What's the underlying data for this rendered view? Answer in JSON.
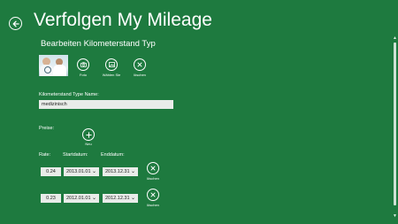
{
  "header": {
    "title": "Verfolgen My Mileage",
    "back_icon": "back-arrow-icon"
  },
  "editor": {
    "section_title": "Bearbeiten Kilometerstand Typ",
    "actions": [
      {
        "label": "Foto",
        "icon": "camera-icon"
      },
      {
        "label": "Wählen Sie",
        "icon": "image-icon"
      },
      {
        "label": "löschen",
        "icon": "close-icon"
      }
    ],
    "name_label": "Kilometerstand Type Name:",
    "name_value": "medizinisch",
    "prices_label": "Preise:",
    "add_label": "Neu",
    "columns": {
      "rate": "Rate:",
      "start": "Startdatum:",
      "end": "Enddatum:"
    },
    "rows": [
      {
        "rate": "0.24",
        "start": "2013.01.01",
        "end": "2013.12.31",
        "delete_label": "löschen"
      },
      {
        "rate": "0.23",
        "start": "2012.01.01",
        "end": "2012.12.31",
        "delete_label": "löschen"
      }
    ]
  },
  "colors": {
    "background": "#1e7a3f",
    "input": "#e9ece9"
  }
}
